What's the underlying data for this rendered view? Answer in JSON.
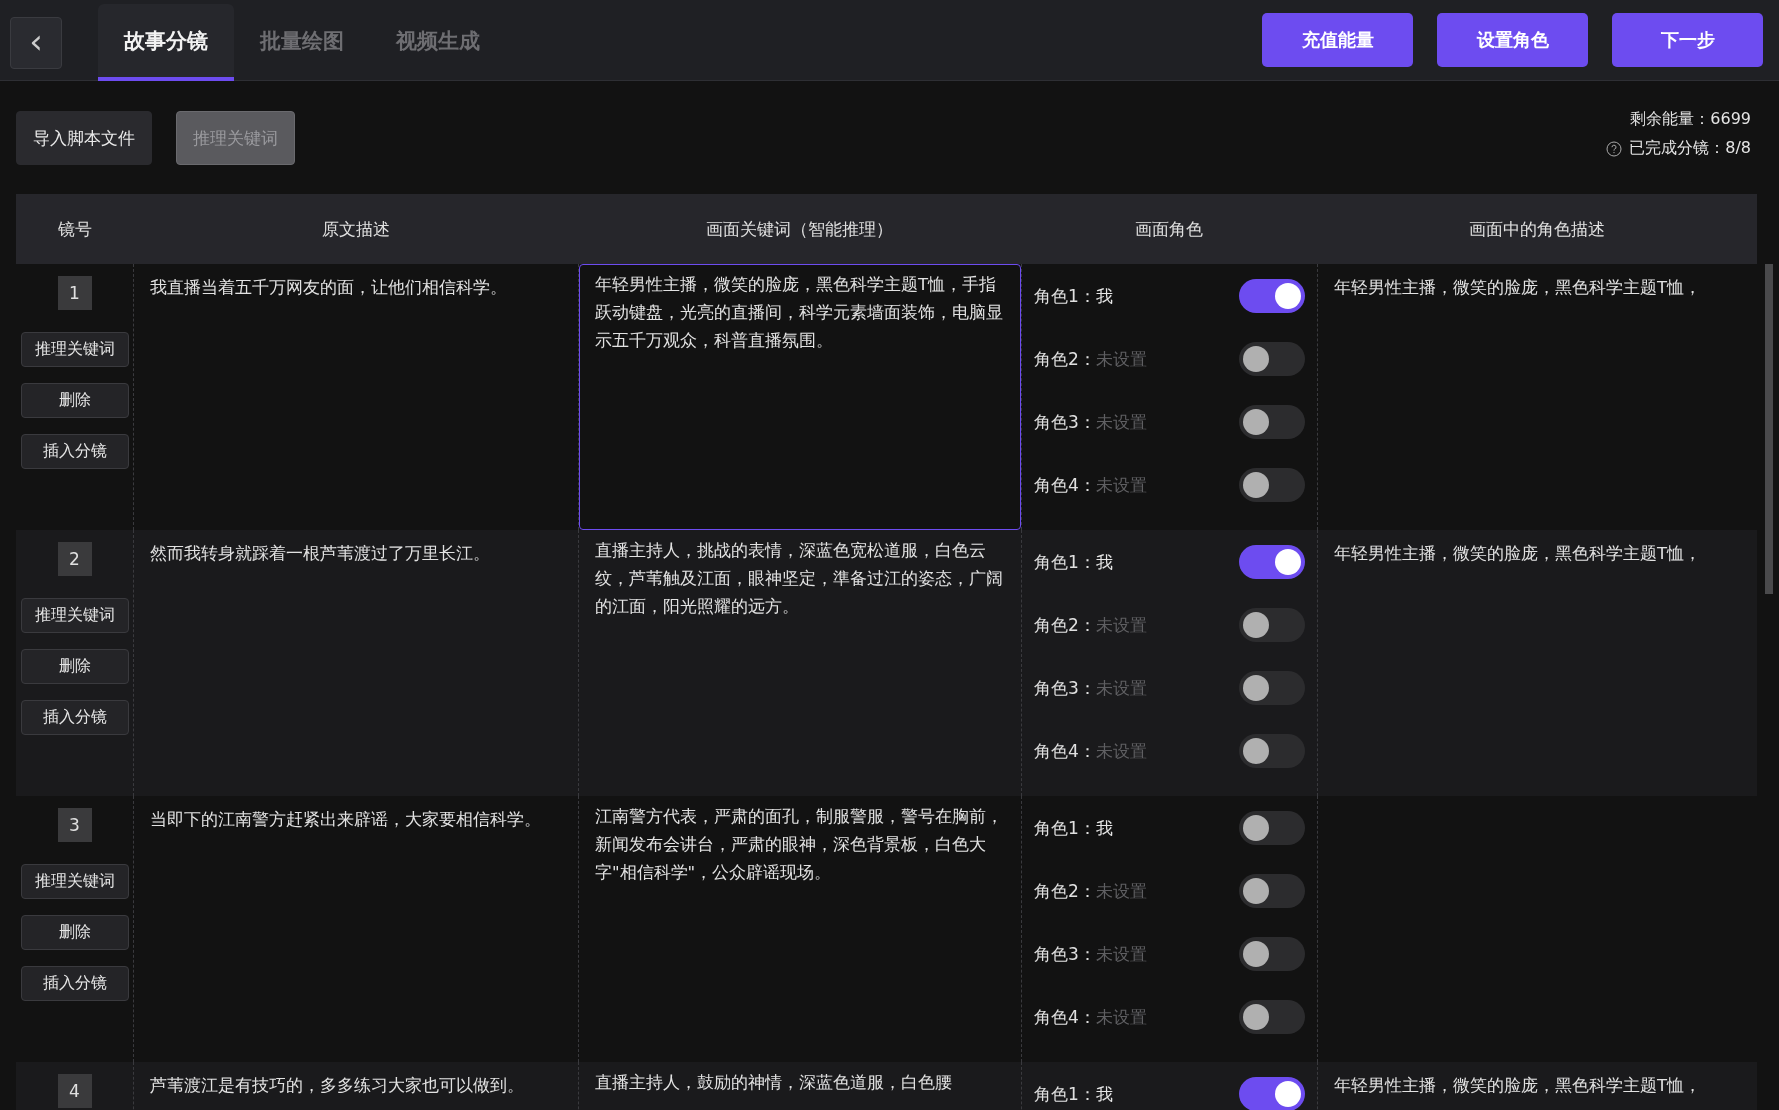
{
  "nav": {
    "back": "‹",
    "tabs": [
      {
        "label": "故事分镜",
        "selected": true
      },
      {
        "label": "批量绘图",
        "selected": false
      },
      {
        "label": "视频生成",
        "selected": false
      }
    ],
    "actions": [
      "充值能量",
      "设置角色",
      "下一步"
    ]
  },
  "toolbar": {
    "buttons": [
      {
        "label": "导入脚本文件",
        "disabled": false
      },
      {
        "label": "推理关键词",
        "disabled": true
      }
    ],
    "energy": "剩余能量：6699",
    "progress": "已完成分镜：8/8"
  },
  "table": {
    "columns": [
      "镜号",
      "原文描述",
      "画面关键词（智能推理）",
      "画面角色",
      "画面中的角色描述"
    ],
    "rows": [
      {
        "number": "1",
        "actions": [
          "推理关键词",
          "删除",
          "插入分镜"
        ],
        "text": "我直播当着五千万网友的面，让他们相信科学。",
        "keywords": "年轻男性主播，微笑的脸庞，黑色科学主题T恤，手指跃动键盘，光亮的直播间，科学元素墙面装饰，电脑显示五千万观众，科普直播氛围。",
        "focused": true,
        "roles": [
          {
            "label": "角色1：",
            "value": "我",
            "set": true,
            "on": true
          },
          {
            "label": "角色2：",
            "value": "未设置",
            "set": false,
            "on": false
          },
          {
            "label": "角色3：",
            "value": "未设置",
            "set": false,
            "on": false
          },
          {
            "label": "角色4：",
            "value": "未设置",
            "set": false,
            "on": false
          }
        ],
        "description": "年轻男性主播，微笑的脸庞，黑色科学主题T恤，"
      },
      {
        "number": "2",
        "actions": [
          "推理关键词",
          "删除",
          "插入分镜"
        ],
        "text": "然而我转身就踩着一根芦苇渡过了万里长江。",
        "keywords": "直播主持人，挑战的表情，深蓝色宽松道服，白色云纹，芦苇触及江面，眼神坚定，準备过江的姿态，广阔的江面，阳光照耀的远方。",
        "focused": false,
        "roles": [
          {
            "label": "角色1：",
            "value": "我",
            "set": true,
            "on": true
          },
          {
            "label": "角色2：",
            "value": "未设置",
            "set": false,
            "on": false
          },
          {
            "label": "角色3：",
            "value": "未设置",
            "set": false,
            "on": false
          },
          {
            "label": "角色4：",
            "value": "未设置",
            "set": false,
            "on": false
          }
        ],
        "description": "年轻男性主播，微笑的脸庞，黑色科学主题T恤，"
      },
      {
        "number": "3",
        "actions": [
          "推理关键词",
          "删除",
          "插入分镜"
        ],
        "text": "当即下的江南警方赶紧出来辟谣，大家要相信科学。",
        "keywords": "江南警方代表，严肃的面孔，制服警服，警号在胸前，新闻发布会讲台，严肃的眼神，深色背景板，白色大字\"相信科学\"，公众辟谣现场。",
        "focused": false,
        "roles": [
          {
            "label": "角色1：",
            "value": "我",
            "set": true,
            "on": false
          },
          {
            "label": "角色2：",
            "value": "未设置",
            "set": false,
            "on": false
          },
          {
            "label": "角色3：",
            "value": "未设置",
            "set": false,
            "on": false
          },
          {
            "label": "角色4：",
            "value": "未设置",
            "set": false,
            "on": false
          }
        ]
      },
      {
        "number": "4",
        "actions": [],
        "text": "芦苇渡江是有技巧的，多多练习大家也可以做到。",
        "keywords": "直播主持人，鼓励的神情，深蓝色道服，白色腰",
        "focused": false,
        "roles": [
          {
            "label": "角色1：",
            "value": "我",
            "set": true,
            "on": true
          }
        ],
        "description": "年轻男性主播，微笑的脸庞，黑色科学主题T恤，"
      }
    ]
  }
}
